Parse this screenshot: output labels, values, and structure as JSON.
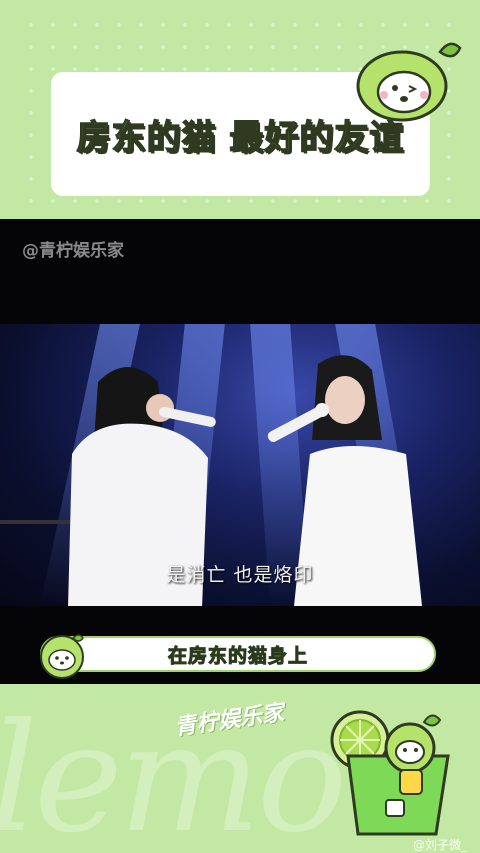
{
  "header": {
    "title": "房东的猫 最好的友谊"
  },
  "video": {
    "watermark": "@青柠娱乐家",
    "subtitle": "是消亡  也是烙印"
  },
  "lyric_bar": {
    "text": "在房东的猫身上"
  },
  "footer": {
    "brand": "青柠娱乐家",
    "background_word": "lemon",
    "weibo_handle": "@刘子微_"
  },
  "colors": {
    "accent_green": "#8fcf52",
    "background": "#c3e8a4",
    "outline": "#2f3a20"
  },
  "icons": [
    "lemon-mascot-icon",
    "lemon-mascot-small-icon",
    "lemon-drink-mascot-icon"
  ]
}
